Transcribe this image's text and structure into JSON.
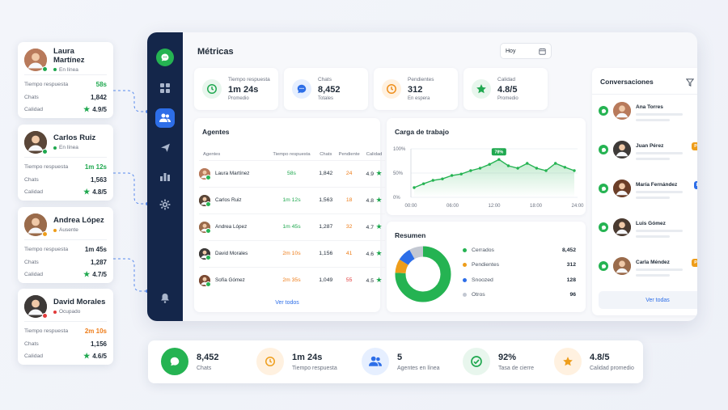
{
  "agents": [
    {
      "name": "Laura Martínez",
      "status": "En línea",
      "status_color": "#1fa84f",
      "response_label": "Tiempo respuesta",
      "response": "58s",
      "response_color": "#1fa84f",
      "chats_label": "Chats",
      "chats": "1,842",
      "rating_label": "Calidad",
      "rating": "4.9/5",
      "avatar_color": "#b87a5b",
      "initial": "LM"
    },
    {
      "name": "Carlos Ruiz",
      "status": "En línea",
      "status_color": "#1fa84f",
      "response_label": "Tiempo respuesta",
      "response": "1m 12s",
      "response_color": "#1fa84f",
      "chats_label": "Chats",
      "chats": "1,563",
      "rating_label": "Calidad",
      "rating": "4.8/5",
      "avatar_color": "#5a4638",
      "initial": "CR"
    },
    {
      "name": "Andrea López",
      "status": "Ausente",
      "status_color": "#ee9d1a",
      "response_label": "Tiempo respuesta",
      "response": "1m 45s",
      "response_color": "#1f2a37",
      "chats_label": "Chats",
      "chats": "1,287",
      "rating_label": "Calidad",
      "rating": "4.7/5",
      "avatar_color": "#9a6b4b",
      "initial": "AL"
    },
    {
      "name": "David Morales",
      "status": "Ocupado",
      "status_color": "#e23b3b",
      "response_label": "Tiempo respuesta",
      "response": "2m 10s",
      "response_color": "#ee7d1a",
      "chats_label": "Chats",
      "chats": "1,156",
      "rating_label": "Calidad",
      "rating": "4.6/5",
      "avatar_color": "#3e3a38",
      "initial": "DM"
    }
  ],
  "window": {
    "title": "Métricas",
    "date_filter": "Hoy",
    "stats": [
      {
        "label": "Tiempo respuesta",
        "value": "1m 24s",
        "sub": "Promedio",
        "color": "#1fa84f",
        "bg": "#e8f6ed",
        "icon": "clock-icon"
      },
      {
        "label": "Chats",
        "value": "8,452",
        "sub": "Totales",
        "color": "#2d6ee8",
        "bg": "#e6efff",
        "icon": "chat-icon"
      },
      {
        "label": "Pendientes",
        "value": "312",
        "sub": "En espera",
        "color": "#ee8d1a",
        "bg": "#fff1e0",
        "icon": "clock-icon"
      },
      {
        "label": "Calidad",
        "value": "4.8/5",
        "sub": "Promedio",
        "color": "#1fa84f",
        "bg": "#e8f6ed",
        "icon": "star-icon"
      }
    ],
    "agents_table": {
      "title": "Agentes",
      "columns": [
        "Agentes",
        "Tiempo respuesta",
        "Chats",
        "Pendiente",
        "Calidad"
      ],
      "rows": [
        {
          "name": "Laura Martínez",
          "time": "58s",
          "time_color": "#1fa84f",
          "chats": "1,842",
          "pending": "24",
          "pending_color": "#ee7d1a",
          "rating": "4.9",
          "avatar_color": "#b87a5b"
        },
        {
          "name": "Carlos Ruiz",
          "time": "1m 12s",
          "time_color": "#1fa84f",
          "chats": "1,563",
          "pending": "18",
          "pending_color": "#ee7d1a",
          "rating": "4.8",
          "avatar_color": "#5a4638"
        },
        {
          "name": "Andrea López",
          "time": "1m 45s",
          "time_color": "#1fa84f",
          "chats": "1,287",
          "pending": "32",
          "pending_color": "#ee7d1a",
          "rating": "4.7",
          "avatar_color": "#9a6b4b"
        },
        {
          "name": "David Morales",
          "time": "2m 10s",
          "time_color": "#ee7d1a",
          "chats": "1,156",
          "pending": "41",
          "pending_color": "#ee7d1a",
          "rating": "4.6",
          "avatar_color": "#3e3a38"
        },
        {
          "name": "Sofía Gómez",
          "time": "2m 35s",
          "time_color": "#ee7d1a",
          "chats": "1,049",
          "pending": "55",
          "pending_color": "#e23b3b",
          "rating": "4.5",
          "avatar_color": "#7b4a33"
        }
      ],
      "link": "Ver todos"
    },
    "workload": {
      "title": "Carga de trabajo",
      "badge": "78%",
      "ylabels": [
        "100%",
        "50%",
        "0%"
      ],
      "xlabels": [
        "00:00",
        "06:00",
        "12:00",
        "18:00",
        "24:00"
      ],
      "values": [
        20,
        28,
        35,
        38,
        45,
        48,
        55,
        60,
        68,
        78,
        65,
        60,
        70,
        60,
        55,
        70,
        62,
        55
      ]
    },
    "summary": {
      "title": "Resumen",
      "items": [
        {
          "label": "Cerrados",
          "value": "8,452",
          "color": "#25b352"
        },
        {
          "label": "Pendientes",
          "value": "312",
          "color": "#ee9d1a"
        },
        {
          "label": "Snoozed",
          "value": "128",
          "color": "#2d6ee8"
        },
        {
          "label": "Otros",
          "value": "96",
          "color": "#c3c8d2"
        }
      ]
    },
    "conversations": {
      "title": "Conversaciones",
      "items": [
        {
          "name": "Ana Torres",
          "badge": "Nueva",
          "badge_color": "#25b352",
          "time": "11:32",
          "avatar_color": "#b87a5b"
        },
        {
          "name": "Juan Pérez",
          "badge": "Pendiente",
          "badge_color": "#ee9d1a",
          "time": "11:28",
          "avatar_color": "#3e3a38"
        },
        {
          "name": "María Fernández",
          "badge": "En curso",
          "badge_color": "#2d6ee8",
          "time": "11:26",
          "avatar_color": "#6b3e28"
        },
        {
          "name": "Luis Gómez",
          "badge": "Nueva",
          "badge_color": "#25b352",
          "time": "11:24",
          "avatar_color": "#4a3a30"
        },
        {
          "name": "Carla Méndez",
          "badge": "Pendiente",
          "badge_color": "#ee9d1a",
          "time": "11:21",
          "avatar_color": "#9a6b4b"
        }
      ],
      "link": "Ver todas"
    }
  },
  "bottom_stats": [
    {
      "value": "8,452",
      "label": "Chats",
      "color": "#25b352",
      "bg": "#25b352",
      "icon": "chat-icon"
    },
    {
      "value": "1m 24s",
      "label": "Tiempo respuesta",
      "color": "#ee9d1a",
      "bg": "#fff1e0",
      "icon": "clock-icon"
    },
    {
      "value": "5",
      "label": "Agentes en línea",
      "color": "#2d6ee8",
      "bg": "#e6efff",
      "icon": "users-icon"
    },
    {
      "value": "92%",
      "label": "Tasa de cierre",
      "color": "#1fa84f",
      "bg": "#e8f6ed",
      "icon": "check-icon"
    },
    {
      "value": "4.8/5",
      "label": "Calidad promedio",
      "color": "#ee9d1a",
      "bg": "#fff1e0",
      "icon": "star-icon"
    }
  ]
}
